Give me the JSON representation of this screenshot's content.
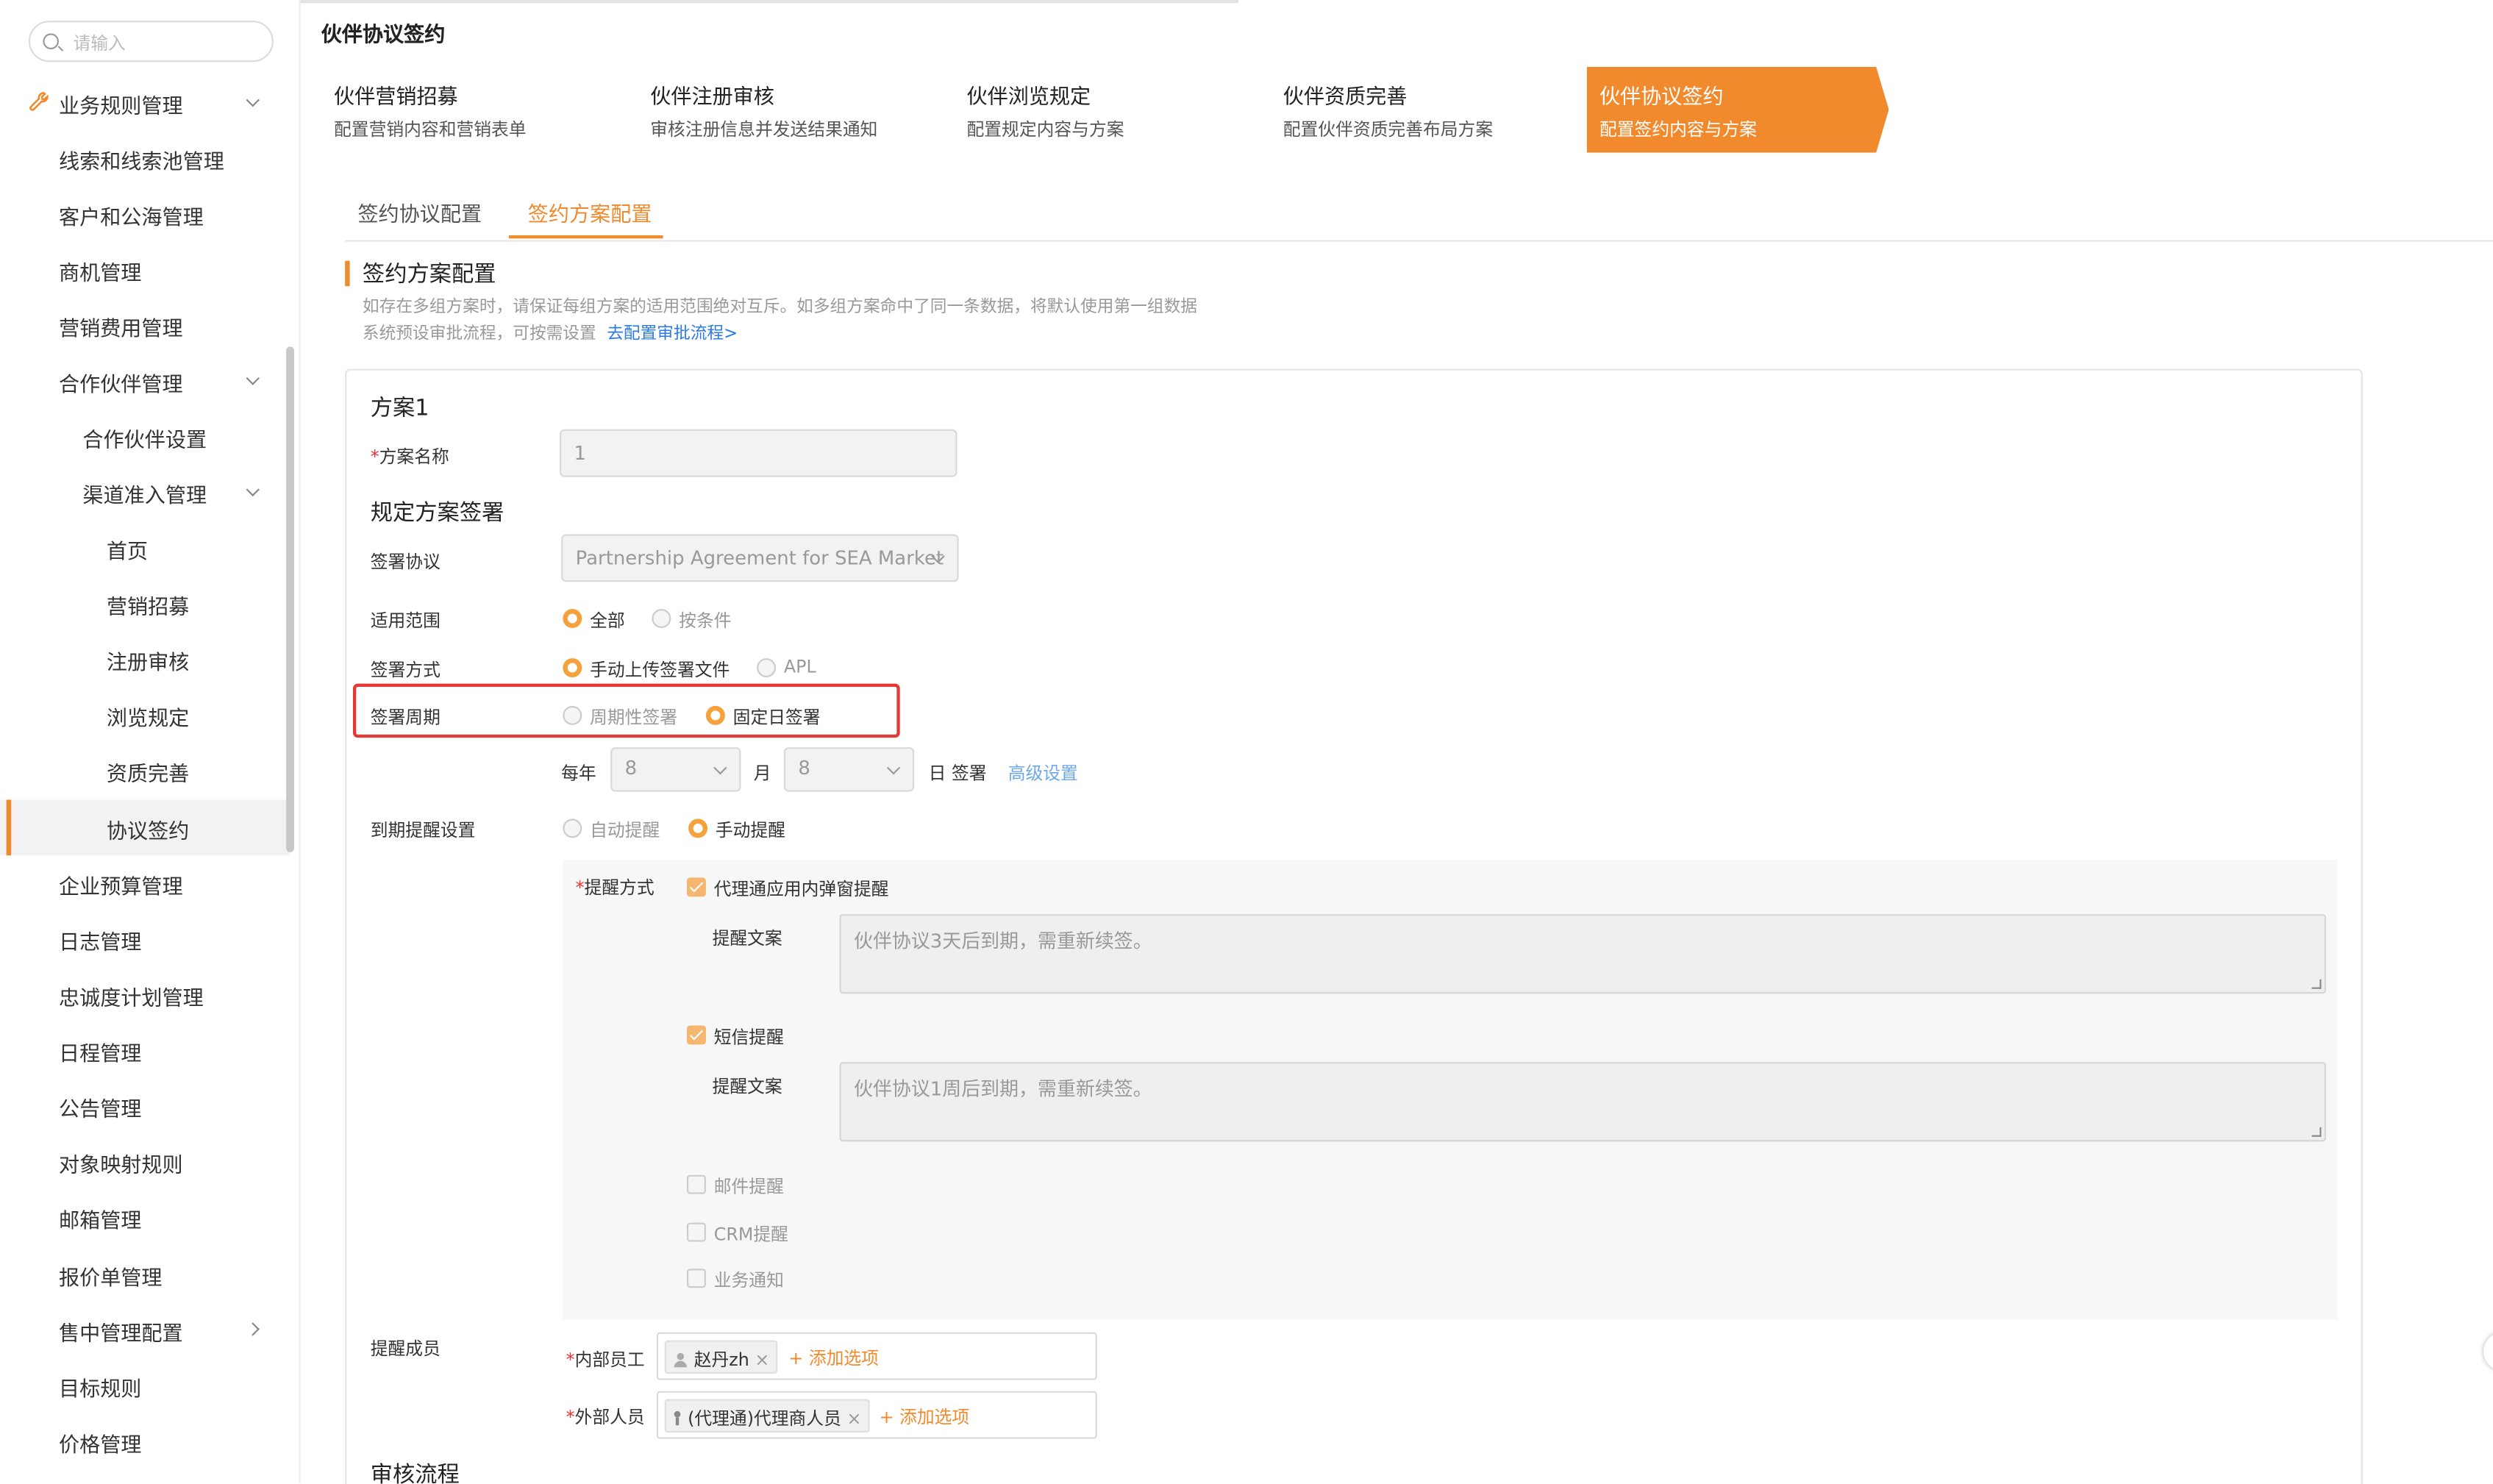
{
  "sidebar": {
    "search_placeholder": "请输入",
    "items": [
      {
        "label": "业务规则管理"
      },
      {
        "label": "线索和线索池管理"
      },
      {
        "label": "客户和公海管理"
      },
      {
        "label": "商机管理"
      },
      {
        "label": "营销费用管理"
      },
      {
        "label": "合作伙伴管理"
      },
      {
        "label": "合作伙伴设置"
      },
      {
        "label": "渠道准入管理"
      },
      {
        "label": "首页"
      },
      {
        "label": "营销招募"
      },
      {
        "label": "注册审核"
      },
      {
        "label": "浏览规定"
      },
      {
        "label": "资质完善"
      },
      {
        "label": "协议签约"
      },
      {
        "label": "企业预算管理"
      },
      {
        "label": "日志管理"
      },
      {
        "label": "忠诚度计划管理"
      },
      {
        "label": "日程管理"
      },
      {
        "label": "公告管理"
      },
      {
        "label": "对象映射规则"
      },
      {
        "label": "邮箱管理"
      },
      {
        "label": "报价单管理"
      },
      {
        "label": "售中管理配置"
      },
      {
        "label": "目标规则"
      },
      {
        "label": "价格管理"
      }
    ]
  },
  "page_title": "伙伴协议签约",
  "steps": [
    {
      "title": "伙伴营销招募",
      "sub": "配置营销内容和营销表单"
    },
    {
      "title": "伙伴注册审核",
      "sub": "审核注册信息并发送结果通知"
    },
    {
      "title": "伙伴浏览规定",
      "sub": "配置规定内容与方案"
    },
    {
      "title": "伙伴资质完善",
      "sub": "配置伙伴资质完善布局方案"
    },
    {
      "title": "伙伴协议签约",
      "sub": "配置签约内容与方案"
    }
  ],
  "tabs": [
    "签约协议配置",
    "签约方案配置"
  ],
  "section": {
    "title": "签约方案配置",
    "hint1": "如存在多组方案时，请保证每组方案的适用范围绝对互斥。如多组方案命中了同一条数据，将默认使用第一组数据",
    "hint2": "系统预设审批流程，可按需设置",
    "hint2_link": "去配置审批流程>"
  },
  "plan": {
    "title": "方案1",
    "name_label": "方案名称",
    "name_value": "1",
    "sub_title": "规定方案签署",
    "agreement_label": "签署协议",
    "agreement_value": "Partnership Agreement for SEA Market",
    "scope_label": "适用范围",
    "scope_opts": [
      "全部",
      "按条件"
    ],
    "method_label": "签署方式",
    "method_opts": [
      "手动上传签署文件",
      "APL"
    ],
    "cycle_label": "签署周期",
    "cycle_opts": [
      "周期性签署",
      "固定日签署"
    ],
    "yearly": "每年",
    "month_value": "8",
    "month_unit": "月",
    "day_value": "8",
    "day_unit": "日 签署",
    "advanced": "高级设置",
    "remind_label": "到期提醒设置",
    "remind_opts": [
      "自动提醒",
      "手动提醒"
    ],
    "remind_method_label": "提醒方式",
    "in_app": "代理通应用内弹窗提醒",
    "copy_label": "提醒文案",
    "in_app_text": "伙伴协议3天后到期，需重新续签。",
    "sms": "短信提醒",
    "sms_text": "伙伴协议1周后到期，需重新续签。",
    "email": "邮件提醒",
    "crm": "CRM提醒",
    "biz": "业务通知",
    "members_label": "提醒成员",
    "internal_label": "内部员工",
    "internal_tag": "赵丹zh",
    "external_label": "外部人员",
    "external_tag": "(代理通)代理商人员",
    "add_option": "+ 添加选项",
    "audit_title": "审核流程"
  },
  "colors": {
    "accent": "#f08a2c",
    "link": "#2c7be5",
    "highlight": "#e53935"
  }
}
